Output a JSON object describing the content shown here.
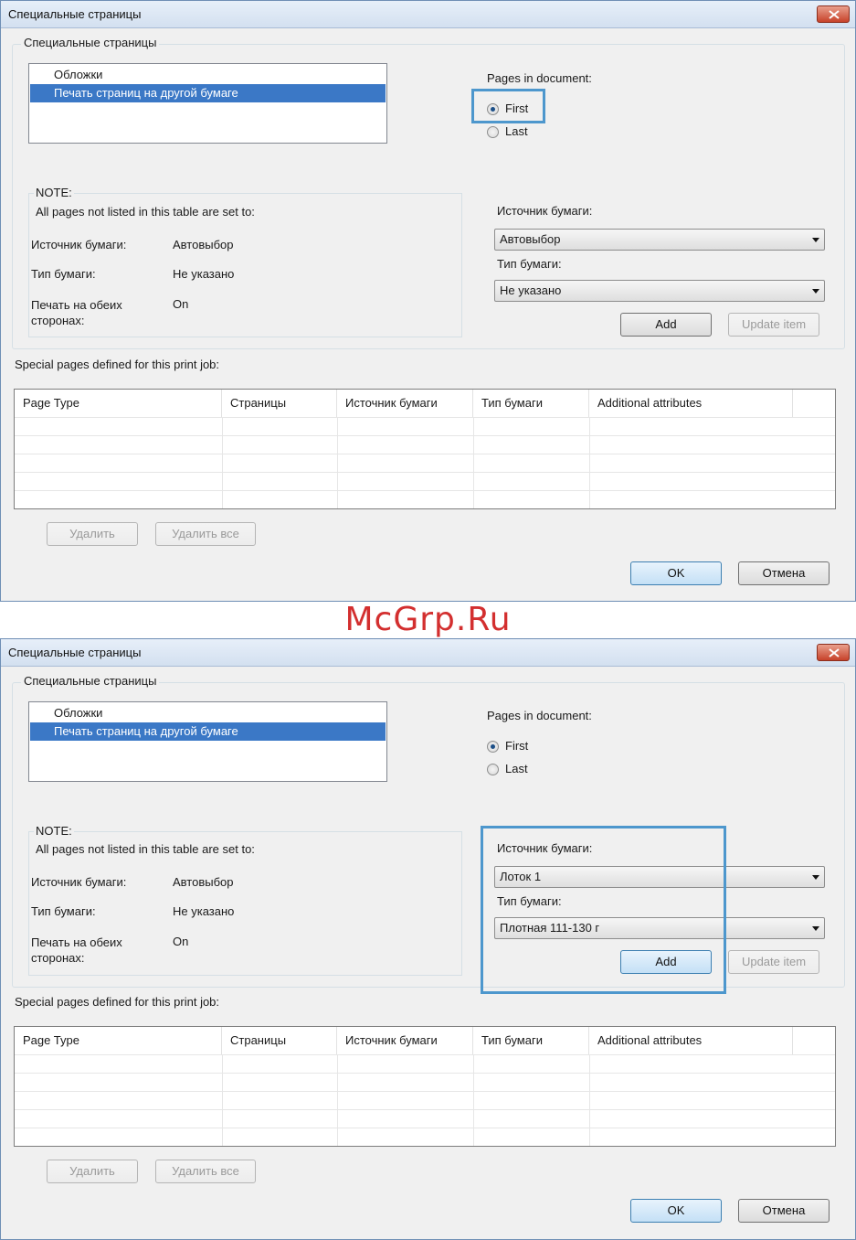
{
  "watermark": "McGrp.Ru",
  "dialogs": [
    {
      "title": "Специальные страницы",
      "group_label": "Специальные страницы",
      "list_items": [
        "Обложки",
        "Печать страниц на другой бумаге"
      ],
      "pages_label": "Pages in document:",
      "radio_first": "First",
      "radio_last": "Last",
      "note_title": "NOTE:",
      "note_text": "All pages not listed in this table are set to:",
      "note_rows": [
        {
          "label": "Источник бумаги:",
          "value": "Автовыбор"
        },
        {
          "label": "Тип бумаги:",
          "value": "Не указано"
        },
        {
          "label": "Печать на обеих сторонах:",
          "value": "On"
        }
      ],
      "source_label": "Источник бумаги:",
      "source_value": "Автовыбор",
      "type_label": "Тип бумаги:",
      "type_value": "Не указано",
      "add": "Add",
      "update": "Update item",
      "special_label": "Special pages defined for this print job:",
      "columns": [
        "Page Type",
        "Страницы",
        "Источник бумаги",
        "Тип бумаги",
        "Additional attributes"
      ],
      "delete": "Удалить",
      "delete_all": "Удалить все",
      "ok": "OK",
      "cancel": "Отмена"
    },
    {
      "title": "Специальные страницы",
      "group_label": "Специальные страницы",
      "list_items": [
        "Обложки",
        "Печать страниц на другой бумаге"
      ],
      "pages_label": "Pages in document:",
      "radio_first": "First",
      "radio_last": "Last",
      "note_title": "NOTE:",
      "note_text": "All pages not listed in this table are set to:",
      "note_rows": [
        {
          "label": "Источник бумаги:",
          "value": "Автовыбор"
        },
        {
          "label": "Тип бумаги:",
          "value": "Не указано"
        },
        {
          "label": "Печать на обеих сторонах:",
          "value": "On"
        }
      ],
      "source_label": "Источник бумаги:",
      "source_value": "Лоток 1",
      "type_label": "Тип бумаги:",
      "type_value": "Плотная 111-130 г",
      "add": "Add",
      "update": "Update item",
      "special_label": "Special pages defined for this print job:",
      "columns": [
        "Page Type",
        "Страницы",
        "Источник бумаги",
        "Тип бумаги",
        "Additional attributes"
      ],
      "delete": "Удалить",
      "delete_all": "Удалить все",
      "ok": "OK",
      "cancel": "Отмена"
    }
  ]
}
